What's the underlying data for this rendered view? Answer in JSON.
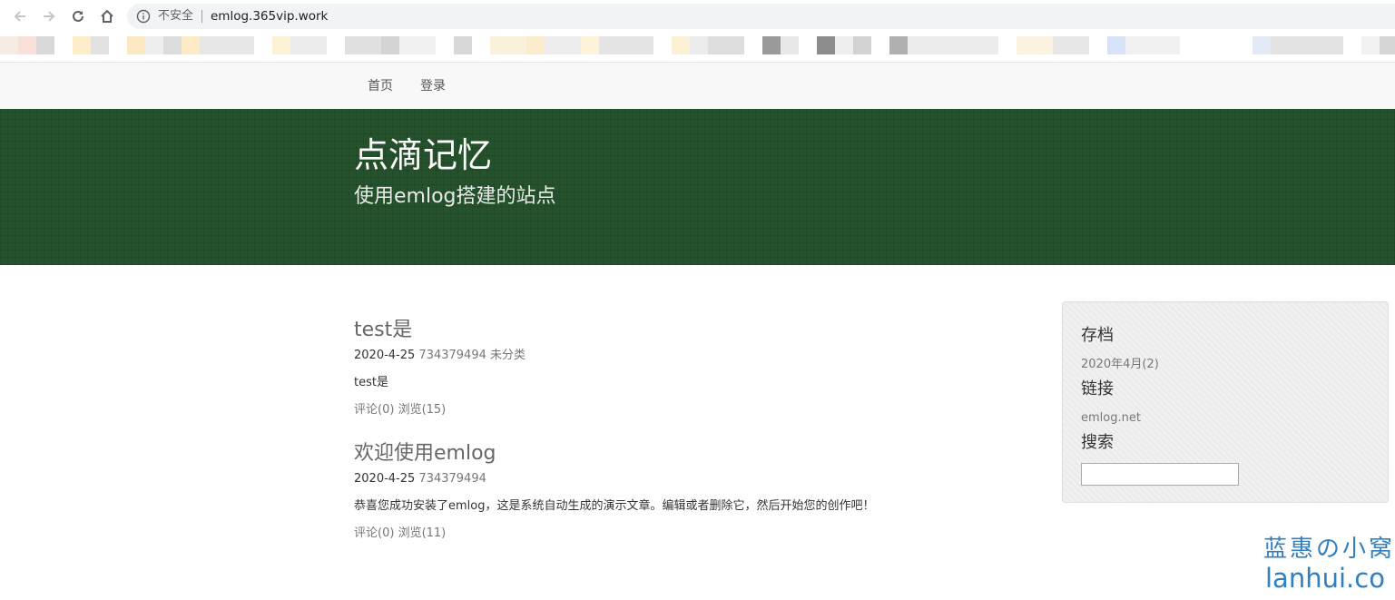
{
  "browser": {
    "insecure_label": "不安全",
    "url": "emlog.365vip.work",
    "icons": [
      "back-icon",
      "forward-icon",
      "reload-icon",
      "home-icon",
      "info-icon"
    ]
  },
  "nav": {
    "items": [
      {
        "label": "首页"
      },
      {
        "label": "登录"
      }
    ]
  },
  "header": {
    "title": "点滴记忆",
    "subtitle": "使用emlog搭建的站点",
    "bg_color": "#25522c"
  },
  "posts": [
    {
      "title": "test是",
      "date": "2020-4-25",
      "author": "734379494",
      "category": "未分类",
      "excerpt": "test是",
      "comments": "评论(0)",
      "views": "浏览(15)"
    },
    {
      "title": "欢迎使用emlog",
      "date": "2020-4-25",
      "author": "734379494",
      "excerpt": "恭喜您成功安装了emlog，这是系统自动生成的演示文章。编辑或者删除它，然后开始您的创作吧！",
      "comments": "评论(0)",
      "views": "浏览(11)"
    }
  ],
  "sidebar": {
    "archive_heading": "存档",
    "archive_item": "2020年4月(2)",
    "links_heading": "链接",
    "link_item": "emlog.net",
    "search_heading": "搜索"
  },
  "watermark": {
    "line1": "蓝惠の小窝",
    "line2": "lanhui.co"
  }
}
